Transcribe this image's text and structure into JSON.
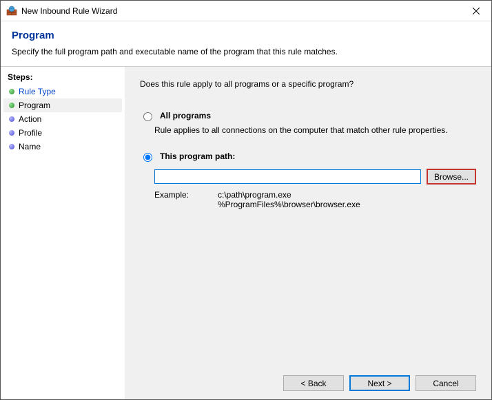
{
  "window": {
    "title": "New Inbound Rule Wizard"
  },
  "header": {
    "title": "Program",
    "subtitle": "Specify the full program path and executable name of the program that this rule matches."
  },
  "sidebar": {
    "steps_label": "Steps:",
    "steps": [
      {
        "label": "Rule Type",
        "state": "done"
      },
      {
        "label": "Program",
        "state": "current"
      },
      {
        "label": "Action",
        "state": "pending"
      },
      {
        "label": "Profile",
        "state": "pending"
      },
      {
        "label": "Name",
        "state": "pending"
      }
    ]
  },
  "main": {
    "question": "Does this rule apply to all programs or a specific program?",
    "options": {
      "all": {
        "label": "All programs",
        "desc": "Rule applies to all connections on the computer that match other rule properties."
      },
      "path": {
        "label": "This program path:",
        "value": "",
        "browse": "Browse...",
        "example_label": "Example:",
        "example_paths": "c:\\path\\program.exe\n%ProgramFiles%\\browser\\browser.exe"
      }
    }
  },
  "footer": {
    "back": "< Back",
    "next": "Next >",
    "cancel": "Cancel"
  }
}
